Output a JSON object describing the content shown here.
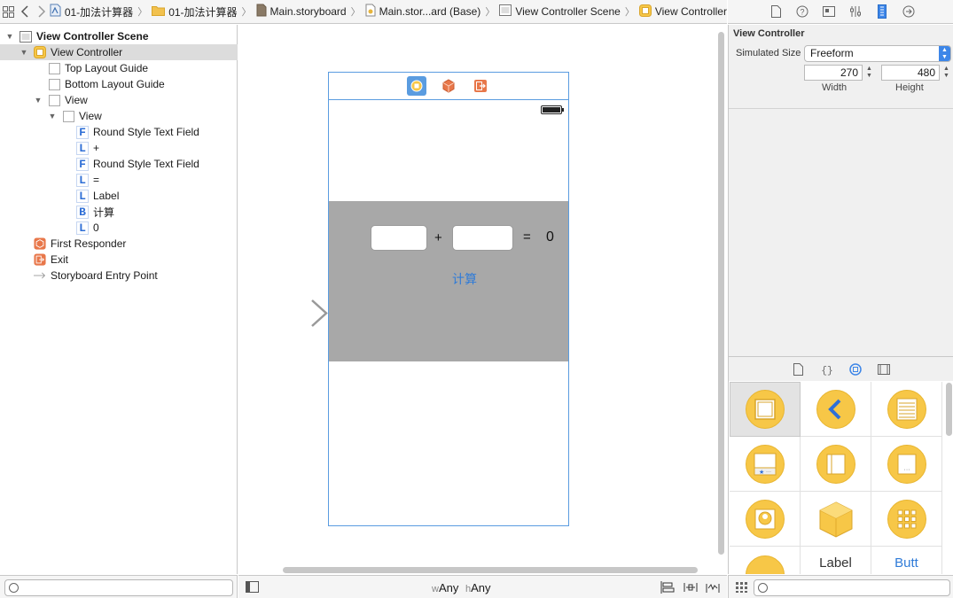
{
  "jumpbar": {
    "crumbs": [
      "01-加法计算器",
      "01-加法计算器",
      "Main.storyboard",
      "Main.stor...ard (Base)",
      "View Controller Scene",
      "View Controller"
    ]
  },
  "outline": {
    "items": [
      {
        "label": "View Controller Scene",
        "level": 0,
        "disclosure": "▼",
        "icon": "scene-icon",
        "bold": true
      },
      {
        "label": "View Controller",
        "level": 1,
        "disclosure": "▼",
        "icon": "view-controller-icon",
        "selected": true
      },
      {
        "label": "Top Layout Guide",
        "level": 2,
        "icon": "layout-guide-icon"
      },
      {
        "label": "Bottom Layout Guide",
        "level": 2,
        "icon": "layout-guide-icon"
      },
      {
        "label": "View",
        "level": 2,
        "disclosure": "▼",
        "icon": "view-icon"
      },
      {
        "label": "View",
        "level": 3,
        "disclosure": "▼",
        "icon": "view-icon"
      },
      {
        "label": "Round Style Text Field",
        "level": 4,
        "letter": "F"
      },
      {
        "label": "+",
        "level": 4,
        "letter": "L"
      },
      {
        "label": "Round Style Text Field",
        "level": 4,
        "letter": "F"
      },
      {
        "label": "=",
        "level": 4,
        "letter": "L"
      },
      {
        "label": "Label",
        "level": 4,
        "letter": "L"
      },
      {
        "label": "计算",
        "level": 4,
        "letter": "B"
      },
      {
        "label": "0",
        "level": 4,
        "letter": "L"
      },
      {
        "label": "First Responder",
        "level": 1,
        "icon": "first-responder-icon"
      },
      {
        "label": "Exit",
        "level": 1,
        "icon": "exit-icon"
      },
      {
        "label": "Storyboard Entry Point",
        "level": 1,
        "icon": "entry-arrow-icon"
      }
    ]
  },
  "scene": {
    "plus": "+",
    "equals": "=",
    "result": "0",
    "button": "计算"
  },
  "canvas_bottom": {
    "w_prefix": "w",
    "w_value": "Any",
    "h_prefix": "h",
    "h_value": "Any"
  },
  "inspector": {
    "title": "View Controller",
    "simulated_size_label": "Simulated Size",
    "simulated_size_value": "Freeform",
    "width_value": "270",
    "height_value": "480",
    "width_label": "Width",
    "height_label": "Height"
  },
  "library": {
    "partial_labels": [
      "Label",
      "Butt"
    ]
  },
  "colors": {
    "accent_blue": "#5a9ce0",
    "button_blue": "#2f7bd8",
    "gray_view": "#a8a8a8",
    "library_yellow": "#f7c747"
  }
}
